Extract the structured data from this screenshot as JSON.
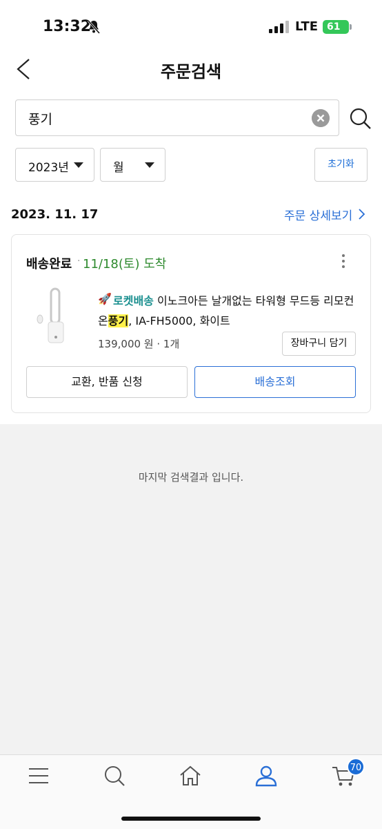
{
  "status_bar": {
    "time": "13:32",
    "network": "LTE",
    "battery": "61"
  },
  "header": {
    "title": "주문검색"
  },
  "search": {
    "value": "풍기"
  },
  "filters": {
    "year": "2023년",
    "month": "월",
    "reset_label": "초기화"
  },
  "order": {
    "date": "2023. 11. 17",
    "detail_link": "주문 상세보기",
    "status": "배송완료",
    "separator": "·",
    "arrival": "11/18(토) 도착",
    "rocket_label": "로켓배송",
    "product_name_part1": "이노크아든 날개없는 타워형 무드등 리모컨",
    "product_name_prefix2": "온",
    "product_highlight": "풍기",
    "product_name_suffix2": ", IA-FH5000, 화이트",
    "price_qty": "139,000 원 · 1개",
    "add_to_cart_label": "장바구니 담기",
    "exchange_label": "교환, 반품 신청",
    "track_label": "배송조회"
  },
  "end_message": "마지막 검색결과 입니다.",
  "bottom_nav": {
    "items": [
      "menu-icon",
      "search-icon",
      "home-icon",
      "my-coupang-icon",
      "cart-icon"
    ],
    "cart_count": "70"
  },
  "colors": {
    "accent": "#2a6fd6",
    "arrival": "#2e8a2e",
    "rocket": "#1a8f8f",
    "highlight": "#fff14a"
  }
}
